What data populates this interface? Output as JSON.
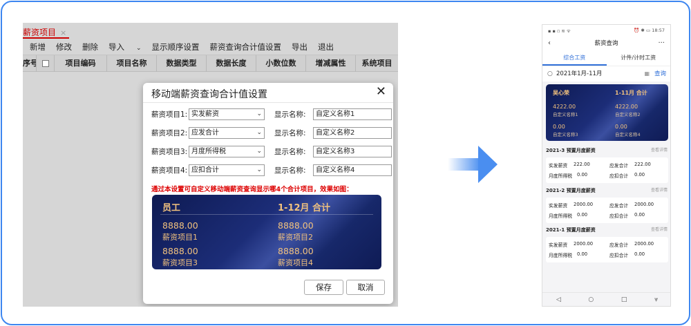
{
  "desktop": {
    "tab_label": "薪资项目",
    "tab_close": "×",
    "toolbar": [
      "新增",
      "修改",
      "删除",
      "导入",
      "显示顺序设置",
      "薪资查询合计值设置",
      "导出",
      "退出"
    ],
    "import_chevron": "chevron-down",
    "columns": [
      "序号",
      "",
      "项目编码",
      "项目名称",
      "数据类型",
      "数据长度",
      "小数位数",
      "增减属性",
      "系统项目"
    ]
  },
  "modal": {
    "title": "移动端薪资查询合计值设置",
    "close": "✕",
    "rows": [
      {
        "label": "薪资项目1:",
        "select": "实发薪资",
        "name_label": "显示名称:",
        "name_value": "自定义名称1"
      },
      {
        "label": "薪资项目2:",
        "select": "应发合计",
        "name_label": "显示名称:",
        "name_value": "自定义名称2"
      },
      {
        "label": "薪资项目3:",
        "select": "月度所得税",
        "name_label": "显示名称:",
        "name_value": "自定义名称3"
      },
      {
        "label": "薪资项目4:",
        "select": "应扣合计",
        "name_label": "显示名称:",
        "name_value": "自定义名称4"
      }
    ],
    "notice": "通过本设置可自定义移动端薪资查询显示哪4个合计项目，效果如图：",
    "preview": {
      "left_title": "员工",
      "right_title": "1-12月 合计",
      "items": [
        {
          "value": "8888.00",
          "name": "薪资项目1"
        },
        {
          "value": "8888.00",
          "name": "薪资项目2"
        },
        {
          "value": "8888.00",
          "name": "薪资项目3"
        },
        {
          "value": "8888.00",
          "name": "薪资项目4"
        }
      ]
    },
    "save_label": "保存",
    "cancel_label": "取消"
  },
  "arrow_color": "#4a8ef0",
  "phone": {
    "status_left": "▪ ▪ ▫ ≋ ᯤ",
    "status_right": "⏰ ✱ ▭ 18:57",
    "back": "‹",
    "title": "薪资查询",
    "more": "···",
    "tabs": [
      "综合工资",
      "计件/计时工资"
    ],
    "search_date": "2021年1月-11月",
    "search_button": "查询",
    "card": {
      "name": "吴心荣",
      "period": "1-11月 合计",
      "items": [
        {
          "value": "4222.00",
          "name": "自定义名称1"
        },
        {
          "value": "4222.00",
          "name": "自定义名称2"
        },
        {
          "value": "0.00",
          "name": "自定义名称3"
        },
        {
          "value": "0.00",
          "name": "自定义名称4"
        }
      ]
    },
    "sections": [
      {
        "title": "2021-3 预置月度薪资",
        "link": "查看详情",
        "a_label": "实发薪资",
        "a_value": "222.00",
        "b_label": "应发合计",
        "b_value": "222.00",
        "c_label": "月度所得税",
        "c_value": "0.00",
        "d_label": "应扣合计",
        "d_value": "0.00"
      },
      {
        "title": "2021-2 预置月度薪资",
        "link": "查看详情",
        "a_label": "实发薪资",
        "a_value": "2000.00",
        "b_label": "应发合计",
        "b_value": "2000.00",
        "c_label": "月度所得税",
        "c_value": "0.00",
        "d_label": "应扣合计",
        "d_value": "0.00"
      },
      {
        "title": "2021-1 预置月度薪资",
        "link": "查看详情",
        "a_label": "实发薪资",
        "a_value": "2000.00",
        "b_label": "应发合计",
        "b_value": "2000.00",
        "c_label": "月度所得税",
        "c_value": "0.00",
        "d_label": "应扣合计",
        "d_value": "0.00"
      }
    ],
    "nav": [
      "◁",
      "○",
      "□",
      "⩔"
    ]
  }
}
